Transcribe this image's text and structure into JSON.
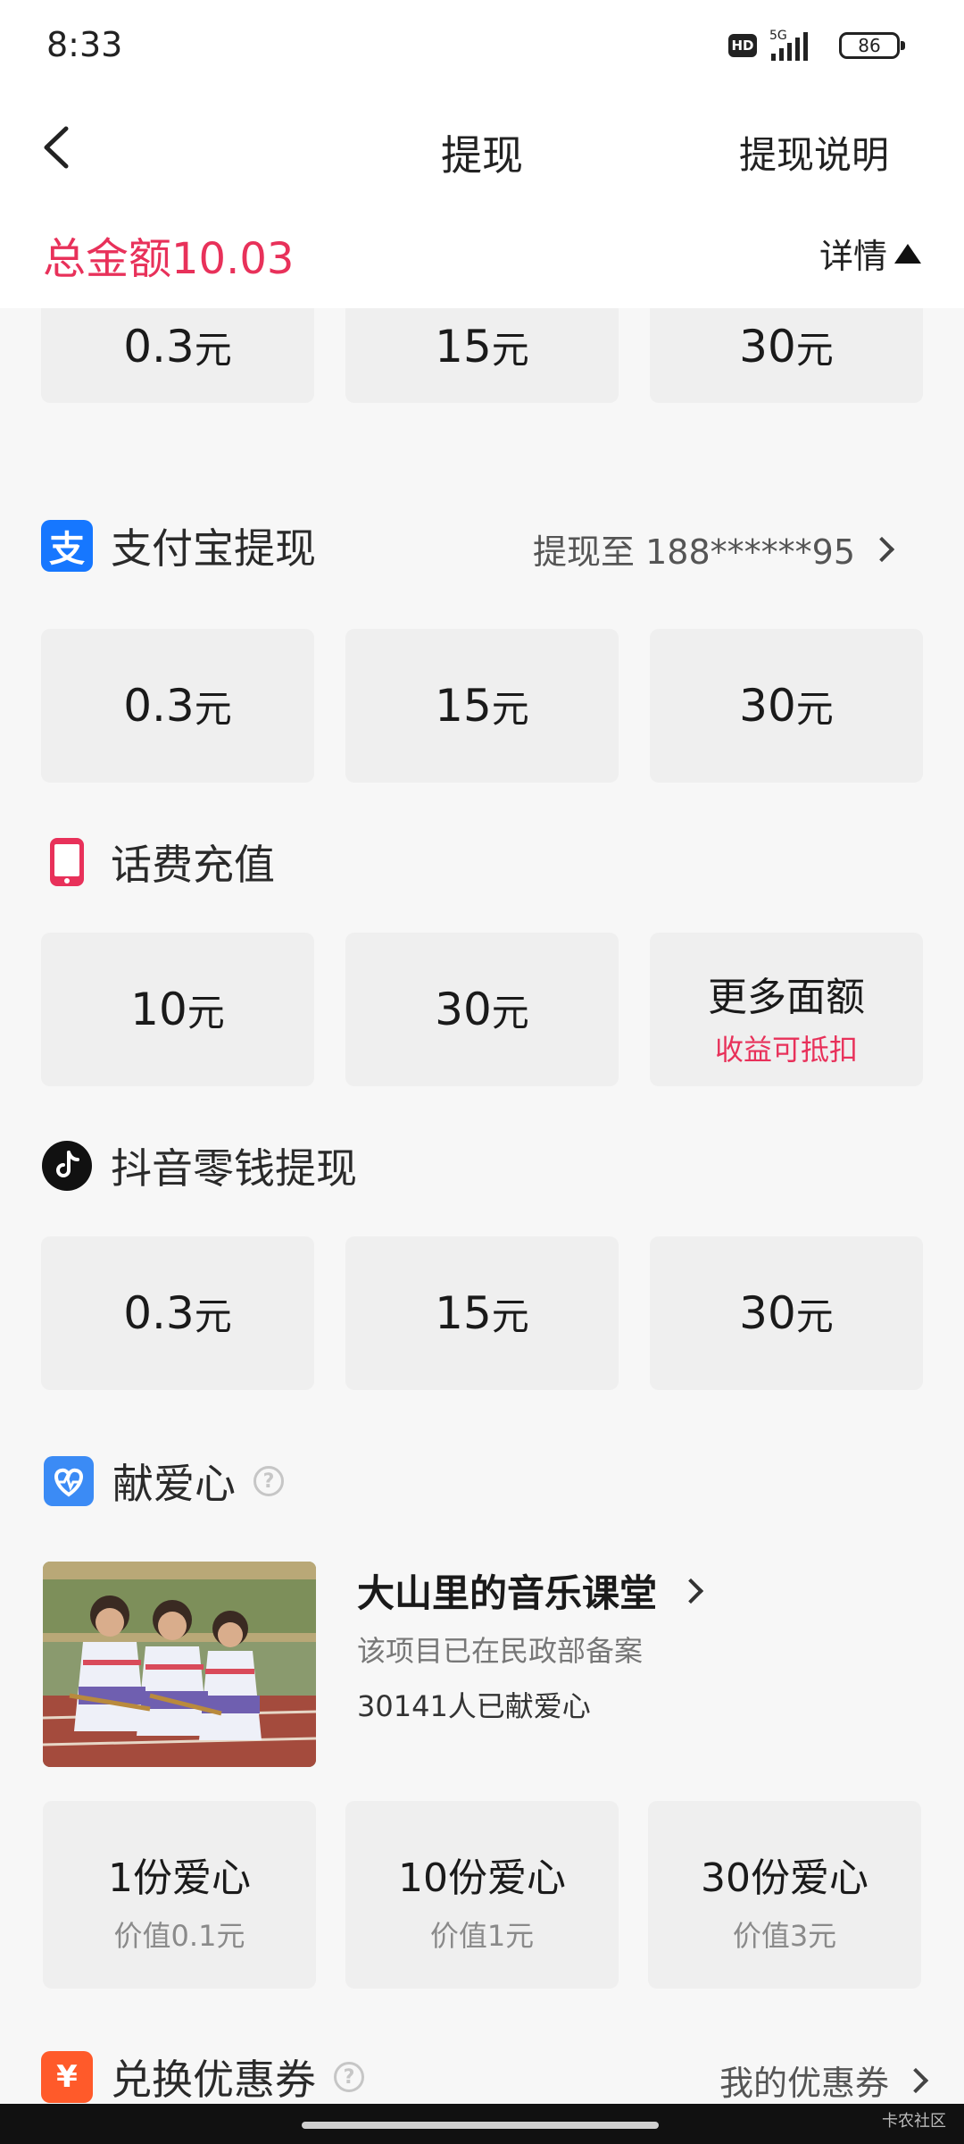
{
  "status": {
    "time": "8:33",
    "network": "5G",
    "hd": "HD",
    "battery": "86"
  },
  "nav": {
    "title": "提现",
    "help": "提现说明"
  },
  "summary": {
    "total": "总金额10.03",
    "detail": "详情"
  },
  "top_partial": {
    "tiles": [
      {
        "amount": "0.3",
        "unit": "元"
      },
      {
        "amount": "15",
        "unit": "元"
      },
      {
        "amount": "30",
        "unit": "元"
      }
    ]
  },
  "alipay": {
    "icon_char": "支",
    "title": "支付宝提现",
    "target": "提现至 188******95",
    "tiles": [
      {
        "amount": "0.3",
        "unit": "元"
      },
      {
        "amount": "15",
        "unit": "元"
      },
      {
        "amount": "30",
        "unit": "元"
      }
    ]
  },
  "phone": {
    "title": "话费充值",
    "tiles": [
      {
        "amount": "10",
        "unit": "元"
      },
      {
        "amount": "30",
        "unit": "元"
      }
    ],
    "more": {
      "main": "更多面额",
      "sub": "收益可抵扣"
    }
  },
  "douyin": {
    "title": "抖音零钱提现",
    "tiles": [
      {
        "amount": "0.3",
        "unit": "元"
      },
      {
        "amount": "15",
        "unit": "元"
      },
      {
        "amount": "30",
        "unit": "元"
      }
    ]
  },
  "charity": {
    "title": "献爱心",
    "help_char": "?",
    "project_title": "大山里的音乐课堂",
    "project_sub": "该项目已在民政部备案",
    "project_count": "30141人已献爱心",
    "tiles": [
      {
        "main": "1份爱心",
        "sub": "价值0.1元"
      },
      {
        "main": "10份爱心",
        "sub": "价值1元"
      },
      {
        "main": "30份爱心",
        "sub": "价值3元"
      }
    ]
  },
  "coupon": {
    "icon_char": "¥",
    "title": "兑换优惠券",
    "help_char": "?",
    "right": "我的优惠券"
  },
  "watermark": "卡农社区",
  "colors": {
    "accent": "#e8315a",
    "alipay": "#1677ff",
    "charity": "#3b8bf5",
    "coupon": "#ff5a2a",
    "tile_bg": "#efefef"
  }
}
